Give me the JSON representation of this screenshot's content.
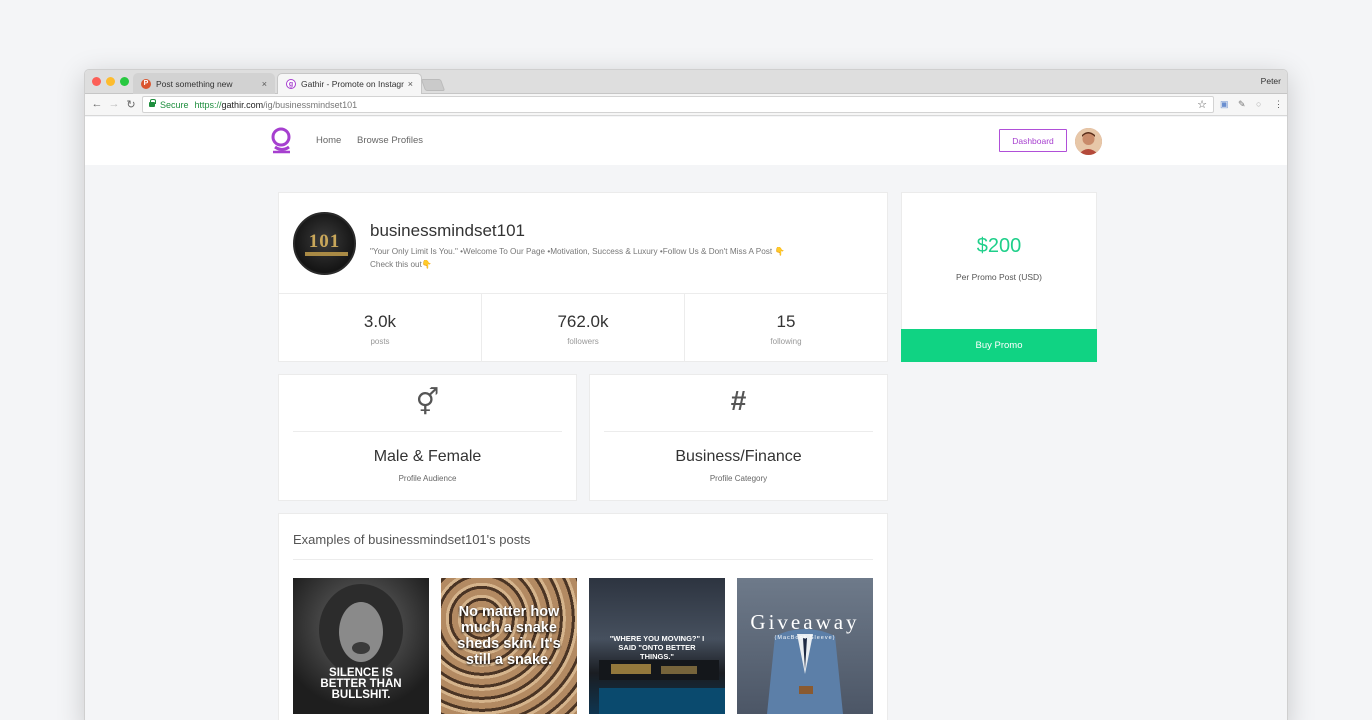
{
  "browser": {
    "tabs": [
      {
        "title": "Post something new",
        "favicon": "P",
        "favicon_color": "#da552f",
        "active": false
      },
      {
        "title": "Gathir - Promote on Instagram",
        "favicon": "g",
        "favicon_color": "#a63fcf",
        "active": true
      }
    ],
    "profile_name": "Peter",
    "secure_label": "Secure",
    "url_scheme": "https://",
    "url_host": "gathir.com",
    "url_path": "/ig/businessmindset101"
  },
  "site": {
    "nav": {
      "home": "Home",
      "browse": "Browse Profiles",
      "dashboard": "Dashboard"
    },
    "accent_color": "#a63fcf",
    "green_color": "#10d383"
  },
  "profile": {
    "avatar_text": "101",
    "username": "businessmindset101",
    "bio_line1": "\"Your Only Limit Is You.\" •Welcome To Our Page •Motivation, Success & Luxury •Follow Us & Don't Miss A Post 👇",
    "bio_line2": "Check this out👇",
    "stats": [
      {
        "value": "3.0k",
        "label": "posts"
      },
      {
        "value": "762.0k",
        "label": "followers"
      },
      {
        "value": "15",
        "label": "following"
      }
    ]
  },
  "pricing": {
    "price": "$200",
    "label": "Per Promo Post (USD)",
    "buy_label": "Buy Promo"
  },
  "audience": {
    "icon": "gender-icon",
    "glyph": "⚥",
    "value": "Male & Female",
    "label": "Profile Audience"
  },
  "category": {
    "icon": "hashtag-icon",
    "glyph": "#",
    "value": "Business/Finance",
    "label": "Profile Category"
  },
  "posts": {
    "title": "Examples of businessmindset101's posts",
    "items": [
      {
        "text": "SILENCE IS BETTER THAN BULLSHIT."
      },
      {
        "text": "No matter how much a snake sheds skin. It's still a snake."
      },
      {
        "text": "\"WHERE YOU MOVING?\" I SAID \"ONTO BETTER THINGS.\""
      },
      {
        "text": "Giveaway",
        "subtext": "(MacBook Sleeve)"
      }
    ]
  }
}
